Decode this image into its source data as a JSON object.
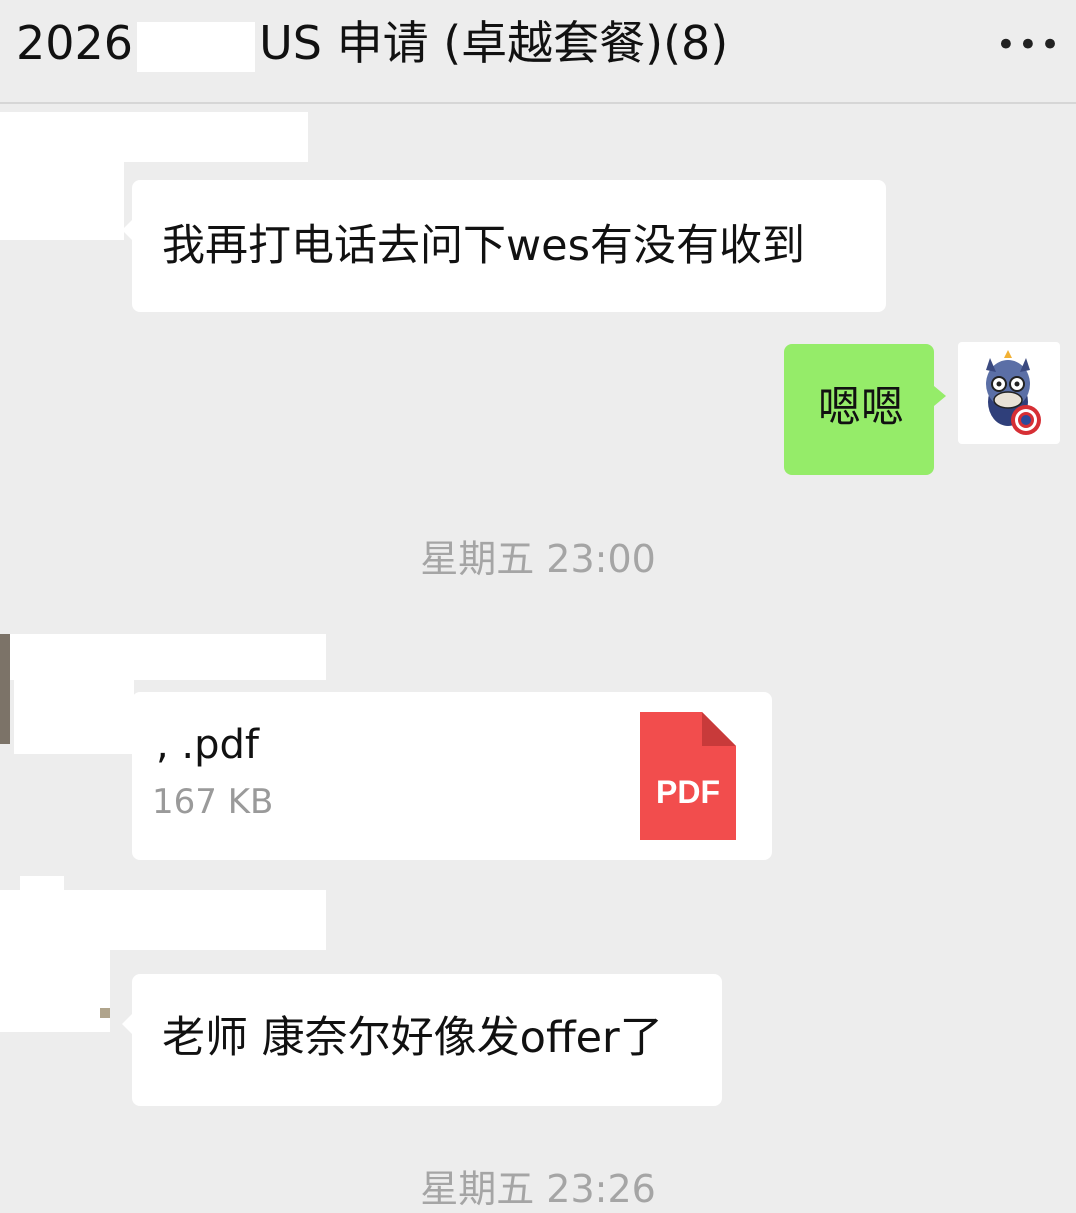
{
  "header": {
    "title_prefix": "2026",
    "title_suffix": "US 申请 (卓越套餐)(8)",
    "more_icon": "more-dots-icon",
    "more_glyph": "•••"
  },
  "messages": [
    {
      "type": "text",
      "side": "left",
      "text": "我再打电话去问下wes有没有收到"
    },
    {
      "type": "text",
      "side": "right",
      "text": "嗯嗯",
      "avatar_icon": "donkey-captain-america-avatar-icon"
    },
    {
      "type": "file",
      "side": "left",
      "file_name": ",     .pdf",
      "file_size": "167 KB",
      "file_icon": "pdf-file-icon",
      "file_icon_label": "PDF"
    },
    {
      "type": "text",
      "side": "left",
      "text": "老师 康奈尔好像发offer了"
    }
  ],
  "timestamps": [
    "星期五 23:00",
    "星期五 23:26"
  ],
  "colors": {
    "background": "#ededed",
    "bubble_self": "#95ec69",
    "bubble_other": "#ffffff",
    "pdf_icon": "#f24d4d",
    "timestamp": "#a5a5a5"
  }
}
